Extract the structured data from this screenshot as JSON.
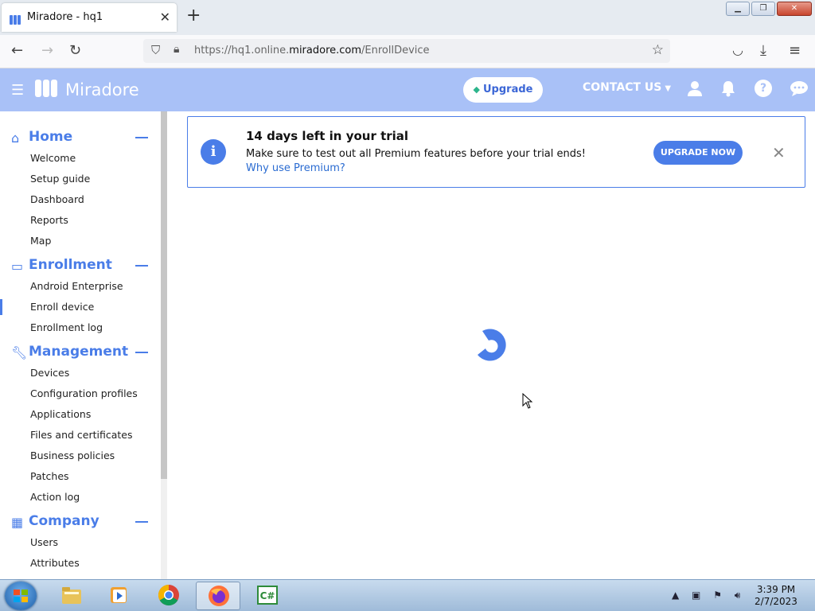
{
  "browser": {
    "tab_title": "Miradore - hq1",
    "tab_close": "✕",
    "new_tab": "+",
    "url_prefix": "https://hq1.online.",
    "url_domain": "miradore.com",
    "url_path": "/EnrollDevice"
  },
  "header": {
    "logo": "Miradore",
    "upgrade_label": "Upgrade",
    "contact_label": "CONTACT US",
    "help_label": "?"
  },
  "sidebar": {
    "sections": [
      {
        "title": "Home",
        "icon": "home-icon",
        "items": [
          "Welcome",
          "Setup guide",
          "Dashboard",
          "Reports",
          "Map"
        ]
      },
      {
        "title": "Enrollment",
        "icon": "laptop-icon",
        "items": [
          "Android Enterprise",
          "Enroll device",
          "Enrollment log"
        ]
      },
      {
        "title": "Management",
        "icon": "wrench-icon",
        "items": [
          "Devices",
          "Configuration profiles",
          "Applications",
          "Files and certificates",
          "Business policies",
          "Patches",
          "Action log"
        ]
      },
      {
        "title": "Company",
        "icon": "building-icon",
        "items": [
          "Users",
          "Attributes"
        ]
      }
    ],
    "active_item": "Enroll device"
  },
  "trial": {
    "title": "14 days left in your trial",
    "message": "Make sure to test out all Premium features before your trial ends!",
    "link": "Why use Premium?",
    "button": "UPGRADE NOW"
  },
  "taskbar": {
    "time": "3:39 PM",
    "date": "2/7/2023"
  },
  "colors": {
    "accent": "#4a7de8",
    "header_bg": "#a9c1f7"
  }
}
